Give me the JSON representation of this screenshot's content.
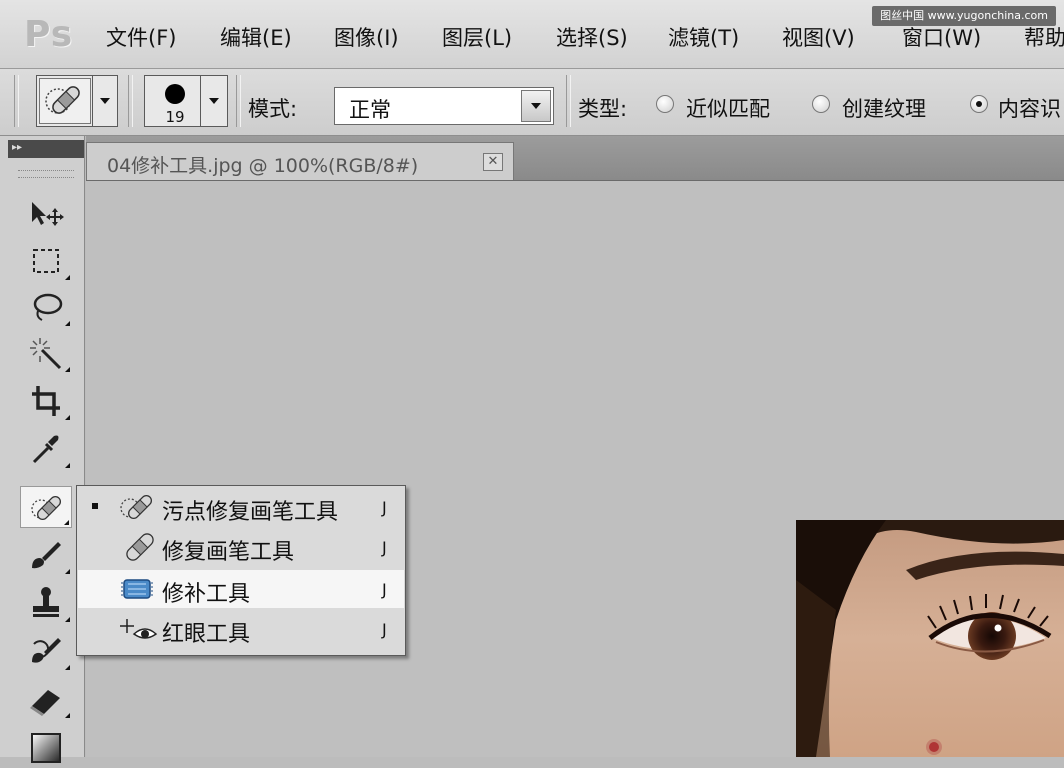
{
  "app": {
    "logo": "Ps",
    "watermark": "图丝中国 www.yugonchina.com"
  },
  "menu": [
    "文件(F)",
    "编辑(E)",
    "图像(I)",
    "图层(L)",
    "选择(S)",
    "滤镜(T)",
    "视图(V)",
    "窗口(W)",
    "帮助"
  ],
  "options": {
    "brush_size": "19",
    "mode_label": "模式:",
    "mode_value": "正常",
    "type_label": "类型:",
    "radios": [
      {
        "label": "近似匹配",
        "checked": false
      },
      {
        "label": "创建纹理",
        "checked": false
      },
      {
        "label": "内容识",
        "checked": true
      }
    ]
  },
  "toolbox": {
    "tools": [
      "move-icon",
      "marquee-icon",
      "lasso-icon",
      "magic-wand-icon",
      "crop-icon",
      "eyedropper-icon",
      "spot-healing-icon",
      "brush-icon",
      "stamp-icon",
      "history-brush-icon",
      "eraser-icon",
      "gradient-icon"
    ]
  },
  "document": {
    "tab_title": "04修补工具.jpg @ 100%(RGB/8#)",
    "close_glyph": "✕"
  },
  "flyout": [
    {
      "label": "污点修复画笔工具",
      "key": "J",
      "icon": "spot-healing-brush-icon",
      "selected": true
    },
    {
      "label": "修复画笔工具",
      "key": "J",
      "icon": "healing-brush-icon",
      "selected": false
    },
    {
      "label": "修补工具",
      "key": "J",
      "icon": "patch-icon",
      "selected": false
    },
    {
      "label": "红眼工具",
      "key": "J",
      "icon": "red-eye-icon",
      "selected": false
    }
  ]
}
